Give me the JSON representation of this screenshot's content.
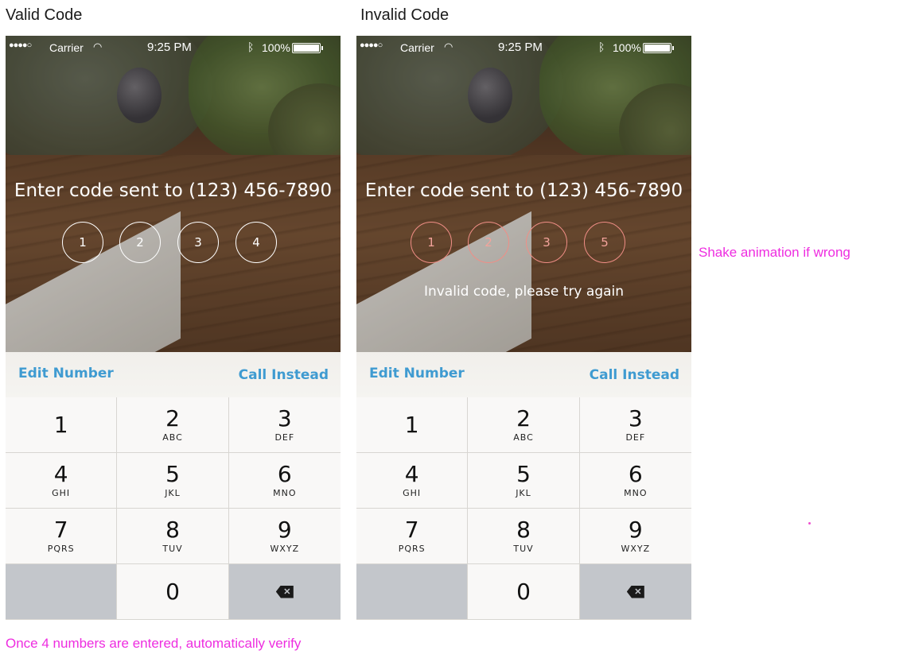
{
  "screens": [
    {
      "title": "Valid Code",
      "status": {
        "signal": "●●●●○",
        "carrier": "Carrier",
        "wifi_icon": "wifi-icon",
        "time": "9:25 PM",
        "bt_icon": "bluetooth-icon",
        "battery": "100%"
      },
      "prompt": "Enter code sent to (123) 456-7890",
      "code_digits": [
        "1",
        "2",
        "3",
        "4"
      ],
      "state": "valid",
      "error_message": "",
      "edit_number_label": "Edit Number",
      "call_instead_label": "Call Instead"
    },
    {
      "title": "Invalid Code",
      "status": {
        "signal": "●●●●○",
        "carrier": "Carrier",
        "wifi_icon": "wifi-icon",
        "time": "9:25 PM",
        "bt_icon": "bluetooth-icon",
        "battery": "100%"
      },
      "prompt": "Enter code sent to (123) 456-7890",
      "code_digits": [
        "1",
        "2",
        "3",
        "5"
      ],
      "state": "invalid",
      "error_message": "Invalid code, please try again",
      "edit_number_label": "Edit Number",
      "call_instead_label": "Call Instead"
    }
  ],
  "keypad": [
    {
      "digit": "1",
      "letters": ""
    },
    {
      "digit": "2",
      "letters": "ABC"
    },
    {
      "digit": "3",
      "letters": "DEF"
    },
    {
      "digit": "4",
      "letters": "GHI"
    },
    {
      "digit": "5",
      "letters": "JKL"
    },
    {
      "digit": "6",
      "letters": "MNO"
    },
    {
      "digit": "7",
      "letters": "PQRS"
    },
    {
      "digit": "8",
      "letters": "TUV"
    },
    {
      "digit": "9",
      "letters": "WXYZ"
    },
    {
      "digit": "",
      "letters": "",
      "type": "blank"
    },
    {
      "digit": "0",
      "letters": ""
    },
    {
      "digit": "",
      "letters": "",
      "type": "delete",
      "icon": "backspace-icon"
    }
  ],
  "notes": {
    "shake": "Shake animation if wrong",
    "auto_verify": "Once 4 numbers are entered, automatically verify"
  },
  "colors": {
    "accent": "#3f9bd1",
    "error_circle": "#f08e86",
    "annotation": "#ee2de0"
  }
}
